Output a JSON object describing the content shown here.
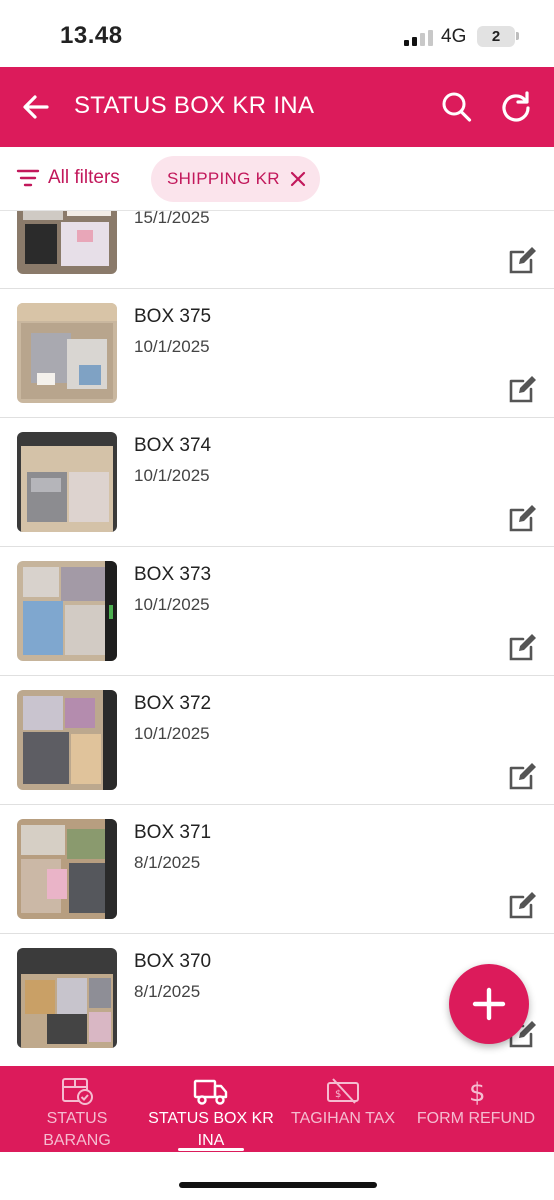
{
  "status_bar": {
    "time": "13.48",
    "network": "4G",
    "battery": "2"
  },
  "app_bar": {
    "title": "STATUS BOX KR INA",
    "back_icon": "arrow-left-icon",
    "search_icon": "search-icon",
    "refresh_icon": "refresh-icon"
  },
  "filters": {
    "all_filters_label": "All filters",
    "chip_label": "SHIPPING KR",
    "chip_close_icon": "close-icon"
  },
  "list": {
    "items": [
      {
        "title": "",
        "date": "15/1/2025"
      },
      {
        "title": "BOX 375",
        "date": "10/1/2025"
      },
      {
        "title": "BOX 374",
        "date": "10/1/2025"
      },
      {
        "title": "BOX 373",
        "date": "10/1/2025"
      },
      {
        "title": "BOX 372",
        "date": "10/1/2025"
      },
      {
        "title": "BOX 371",
        "date": "8/1/2025"
      },
      {
        "title": "BOX 370",
        "date": "8/1/2025"
      }
    ]
  },
  "fab": {
    "icon": "plus-icon"
  },
  "bottom_nav": {
    "items": [
      {
        "label": "STATUS BARANG",
        "icon": "box-check-icon",
        "active": false
      },
      {
        "label": "STATUS BOX KR INA",
        "icon": "truck-icon",
        "active": true
      },
      {
        "label": "TAGIHAN TAX",
        "icon": "tax-ticket-icon",
        "active": false
      },
      {
        "label": "FORM REFUND",
        "icon": "dollar-icon",
        "active": false
      }
    ]
  },
  "colors": {
    "primary": "#dc1b5b",
    "chip_bg": "#fbe4ec",
    "chip_text": "#c2185b"
  }
}
